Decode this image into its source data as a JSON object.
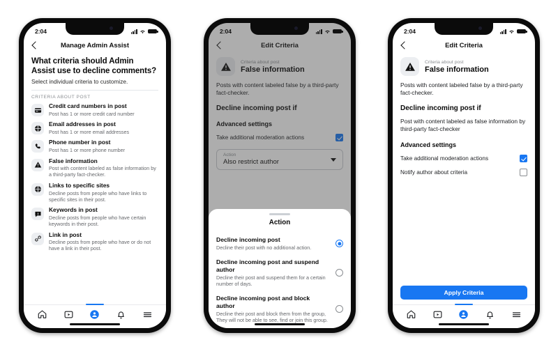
{
  "status": {
    "time": "2:04",
    "signal_icon": "cellular-bars-icon",
    "wifi_icon": "wifi-icon",
    "battery_icon": "battery-icon"
  },
  "phone1": {
    "nav": {
      "back_icon": "back-chevron-icon",
      "title": "Manage Admin Assist"
    },
    "heading": "What criteria should Admin Assist use to decline comments?",
    "subheading": "Select individual criteria to customize.",
    "section_caption": "CRITERIA ABOUT POST",
    "criteria": [
      {
        "icon": "credit-card-icon",
        "name": "Credit card numbers in post",
        "desc": "Post has 1 or more credit card number"
      },
      {
        "icon": "globe-icon",
        "name": "Email addresses in post",
        "desc": "Post has 1 or more email addresses"
      },
      {
        "icon": "phone-icon",
        "name": "Phone number in post",
        "desc": "Post has 1 or more phone number"
      },
      {
        "icon": "warning-triangle-icon",
        "name": "False information",
        "desc": "Post with content labeled as false information by a third-party fact-checker."
      },
      {
        "icon": "globe-icon",
        "name": "Links to specific sites",
        "desc": "Decline posts from people who have links to specific sites in their post."
      },
      {
        "icon": "comment-icon",
        "name": "Keywords in post",
        "desc": "Decline posts from people who have certain keywords in their post."
      },
      {
        "icon": "link-icon",
        "name": "Link in post",
        "desc": "Decline posts from people who have or do not have a link in their post."
      }
    ]
  },
  "phone2": {
    "nav": {
      "back_icon": "back-chevron-icon",
      "title": "Edit Criteria"
    },
    "criteria_eyebrow": "Criteria about post",
    "criteria_name": "False information",
    "criteria_icon": "warning-triangle-icon",
    "description": "Posts with content labeled false by a third-party fact-checker.",
    "decline_heading": "Decline incoming post if",
    "advanced_heading": "Advanced settings",
    "advanced_toggle_label": "Take additional moderation actions",
    "advanced_toggle_checked": true,
    "select": {
      "label": "Action",
      "value": "Also restrict author",
      "caret_icon": "chevron-down-icon"
    },
    "sheet": {
      "grabber_icon": "sheet-grabber-icon",
      "title": "Action",
      "options": [
        {
          "name": "Decline incoming post",
          "desc": "Decline their post with no additional action.",
          "selected": true
        },
        {
          "name": "Decline incoming post and suspend author",
          "desc": "Decline their post and suspend them for a certain number of days.",
          "selected": false
        },
        {
          "name": "Decline incoming post and block author",
          "desc": "Decline their post and block them from the group, They will not be able to see, find or join this group.",
          "selected": false
        }
      ]
    }
  },
  "phone3": {
    "nav": {
      "back_icon": "back-chevron-icon",
      "title": "Edit Criteria"
    },
    "criteria_eyebrow": "Criteria about post",
    "criteria_name": "False information",
    "criteria_icon": "warning-triangle-icon",
    "description": "Posts with content labeled false by a third-party fact-checker.",
    "decline_heading": "Decline incoming post if",
    "decline_value": "Post with content labeled as false information by third-party fact-checker",
    "advanced_heading": "Advanced settings",
    "toggles": [
      {
        "label": "Take additional moderation actions",
        "checked": true
      },
      {
        "label": "Notify author about criteria",
        "checked": false
      }
    ],
    "apply_button": "Apply Criteria"
  },
  "tabbar": {
    "items": [
      {
        "icon": "home-icon",
        "active": false
      },
      {
        "icon": "video-icon",
        "active": false
      },
      {
        "icon": "groups-icon",
        "active": true
      },
      {
        "icon": "bell-icon",
        "active": false
      },
      {
        "icon": "menu-icon",
        "active": false
      }
    ]
  },
  "colors": {
    "accent": "#1877F2",
    "icon_bg": "#eceef1",
    "muted_text": "#65676b",
    "frame": "#0b0b0b"
  }
}
